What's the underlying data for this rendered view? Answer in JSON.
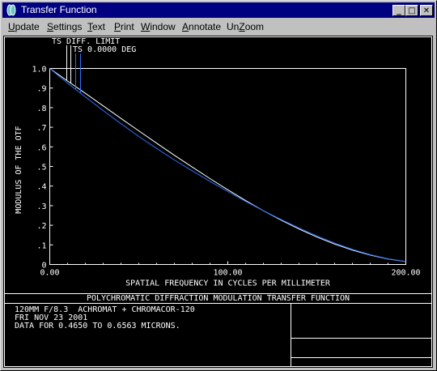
{
  "window": {
    "title": "Transfer Function",
    "minimize_glyph": "_",
    "maximize_glyph": "□",
    "close_glyph": "✕"
  },
  "menu": [
    {
      "label": "Update",
      "underline": "U",
      "rest": "pdate"
    },
    {
      "label": "Settings",
      "underline": "S",
      "rest": "ettings"
    },
    {
      "label": "Text",
      "underline": "T",
      "rest": "ext"
    },
    {
      "label": "Print",
      "underline": "P",
      "rest": "rint"
    },
    {
      "label": "Window",
      "underline": "W",
      "rest": "indow"
    },
    {
      "label": "Annotate",
      "underline": "A",
      "rest": "nnotate"
    },
    {
      "label": "UnZoom",
      "prefix": "Un",
      "underline": "Z",
      "rest": "oom"
    }
  ],
  "plot": {
    "legend_line1": "TS DIFF. LIMIT",
    "legend_line2": "TS 0.0000 DEG"
  },
  "chart_data": {
    "type": "line",
    "xlabel": "SPATIAL FREQUENCY IN CYCLES PER MILLIMETER",
    "ylabel": "MODULUS OF THE OTF",
    "xlim": [
      0,
      200
    ],
    "ylim": [
      0,
      1.0
    ],
    "x_ticks": [
      "0.00",
      "100.00",
      "200.00"
    ],
    "y_ticks": [
      "0",
      ".1",
      ".2",
      ".3",
      ".4",
      ".5",
      ".6",
      ".7",
      ".8",
      ".9",
      "1.0"
    ],
    "grid": false,
    "series": [
      {
        "name": "DIFF. LIMIT",
        "color": "#ffffff",
        "x": [
          0,
          10,
          20,
          30,
          40,
          50,
          60,
          70,
          80,
          90,
          100,
          110,
          120,
          130,
          140,
          150,
          160,
          170,
          180,
          190,
          200
        ],
        "y": [
          1.0,
          0.936,
          0.873,
          0.809,
          0.745,
          0.682,
          0.619,
          0.557,
          0.497,
          0.438,
          0.381,
          0.326,
          0.274,
          0.226,
          0.181,
          0.14,
          0.104,
          0.073,
          0.048,
          0.028,
          0.015
        ]
      },
      {
        "name": "0.0000 DEG",
        "color": "#2a6fff",
        "x": [
          0,
          10,
          20,
          30,
          40,
          50,
          60,
          70,
          80,
          90,
          100,
          110,
          120,
          130,
          140,
          150,
          160,
          170,
          180,
          190,
          200
        ],
        "y": [
          1.0,
          0.925,
          0.855,
          0.785,
          0.718,
          0.653,
          0.592,
          0.533,
          0.478,
          0.424,
          0.372,
          0.322,
          0.274,
          0.229,
          0.186,
          0.146,
          0.109,
          0.077,
          0.05,
          0.029,
          0.015
        ]
      }
    ]
  },
  "footer": {
    "caption": "POLYCHROMATIC DIFFRACTION MODULATION TRANSFER FUNCTION",
    "line1": "120MM F/8.3  ACHROMAT + CHROMACOR-120",
    "line2": "FRI NOV 23 2001",
    "line3": "DATA FOR 0.4650 TO 0.6563 MICRONS."
  }
}
